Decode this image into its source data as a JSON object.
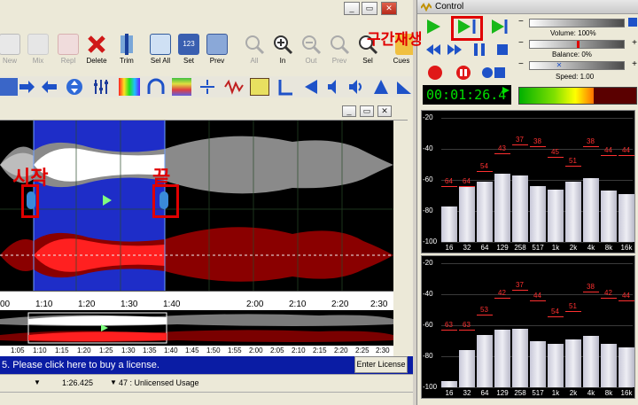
{
  "editor": {
    "toolbar": {
      "buttons": [
        {
          "label": "New",
          "enabled": false
        },
        {
          "label": "Mix",
          "enabled": false
        },
        {
          "label": "Repl",
          "enabled": false
        },
        {
          "label": "Delete",
          "enabled": true
        },
        {
          "label": "Trim",
          "enabled": true
        },
        {
          "label": "Sel All",
          "enabled": true
        },
        {
          "label": "Set",
          "enabled": true
        },
        {
          "label": "Prev",
          "enabled": true
        },
        {
          "label": "All",
          "enabled": false
        },
        {
          "label": "In",
          "enabled": true
        },
        {
          "label": "Out",
          "enabled": false
        },
        {
          "label": "Prev",
          "enabled": false
        },
        {
          "label": "Sel",
          "enabled": true
        },
        {
          "label": "Cues",
          "enabled": true
        }
      ],
      "set_icon_text": "123"
    },
    "timeline": {
      "ticks": [
        "00",
        "1:10",
        "1:20",
        "1:30",
        "1:40",
        "2:00",
        "2:10",
        "2:20",
        "2:30"
      ],
      "overview_ticks": [
        "1:05",
        "1:10",
        "1:15",
        "1:20",
        "1:25",
        "1:30",
        "1:35",
        "1:40",
        "1:45",
        "1:50",
        "1:55",
        "2:00",
        "2:05",
        "2:10",
        "2:15",
        "2:20",
        "2:25",
        "2:30"
      ]
    },
    "status": {
      "message": "5. Please click here to buy a license.",
      "enter_license": "Enter License",
      "position": "1:26.425",
      "usage": "47 : Unlicensed Usage"
    },
    "annotations": {
      "start": "시작",
      "end": "끝",
      "section_play": "구간재생"
    }
  },
  "control": {
    "title": "Control",
    "volume": {
      "label": "Volume: 100%",
      "value": 1.0
    },
    "balance": {
      "label": "Balance: 0%",
      "value": 0.5
    },
    "speed": {
      "label": "Speed: 1.00",
      "value": 0.3
    },
    "time": "00:01:26.4",
    "spectrum_top": {
      "y_labels": [
        "-20",
        "-40",
        "-60",
        "-80",
        "-100"
      ],
      "x_labels": [
        "16",
        "32",
        "64",
        "129",
        "258",
        "517",
        "1k",
        "2k",
        "4k",
        "8k",
        "16k"
      ],
      "values": [
        -77,
        -64,
        -61,
        -56,
        -57,
        -64,
        -66,
        -61,
        -59,
        -67,
        -69
      ],
      "peaks": [
        -64,
        -64,
        -54,
        -43,
        -37,
        -38,
        -45,
        -51,
        -38,
        -44,
        -44
      ]
    },
    "spectrum_bottom": {
      "y_labels": [
        "-20",
        "-40",
        "-60",
        "-80",
        "-100"
      ],
      "x_labels": [
        "16",
        "32",
        "64",
        "129",
        "258",
        "517",
        "1k",
        "2k",
        "4k",
        "8k",
        "16k"
      ],
      "values": [
        -96,
        -76,
        -66,
        -63,
        -62,
        -70,
        -72,
        -69,
        -67,
        -72,
        -74
      ],
      "peaks": [
        -63,
        -63,
        -53,
        -42,
        -37,
        -44,
        -54,
        -51,
        -38,
        -42,
        -44
      ]
    },
    "colors": {
      "accent_red": "#e00000",
      "time_green": "#00e000",
      "status_blue": "#0a1ca4"
    }
  }
}
